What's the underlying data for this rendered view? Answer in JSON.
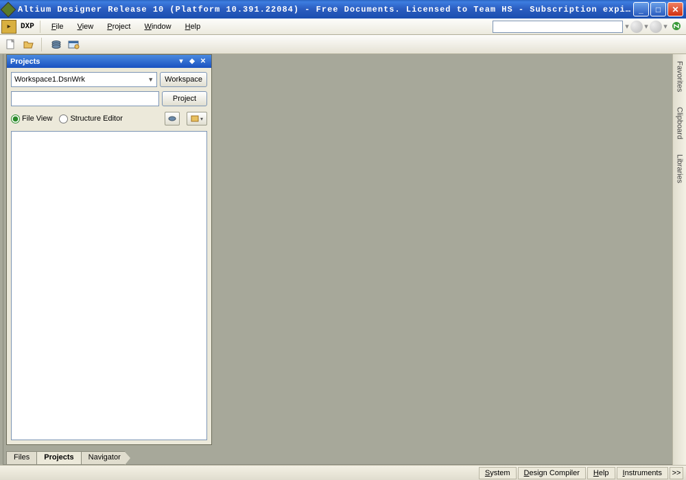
{
  "titlebar": {
    "text": "Altium Designer Release 10 (Platform 10.391.22084) - Free Documents. Licensed to Team HS - Subscription expir..."
  },
  "menu": {
    "dxp": "DXP",
    "file": "File",
    "view": "View",
    "project": "Project",
    "window": "Window",
    "help": "Help"
  },
  "projects_panel": {
    "title": "Projects",
    "workspace_value": "Workspace1.DsnWrk",
    "workspace_btn": "Workspace",
    "project_btn": "Project",
    "file_view": "File View",
    "structure_editor": "Structure Editor"
  },
  "left_tabs": {
    "files": "Files",
    "projects": "Projects",
    "navigator": "Navigator"
  },
  "right_rail": {
    "favorites": "Favorites",
    "clipboard": "Clipboard",
    "libraries": "Libraries"
  },
  "statusbar": {
    "system": "System",
    "design_compiler": "Design Compiler",
    "help": "Help",
    "instruments": "Instruments",
    "more": ">>"
  }
}
